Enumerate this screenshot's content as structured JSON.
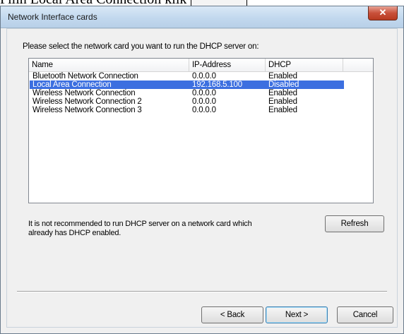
{
  "document": {
    "clipped_text": "Pilih Local Area Connection klik"
  },
  "window": {
    "title": "Network Interface cards",
    "close_symbol": "✕"
  },
  "instruction": "Please select the network card you want to run the DHCP server on:",
  "list": {
    "columns": [
      "Name",
      "IP-Address",
      "DHCP"
    ],
    "rows": [
      {
        "name": "Bluetooth Network Connection",
        "ip": "0.0.0.0",
        "dhcp": "Enabled",
        "selected": false
      },
      {
        "name": "Local Area Connection",
        "ip": "192.168.5.100",
        "dhcp": "Disabled",
        "selected": true
      },
      {
        "name": "Wireless Network Connection",
        "ip": "0.0.0.0",
        "dhcp": "Enabled",
        "selected": false
      },
      {
        "name": "Wireless Network Connection 2",
        "ip": "0.0.0.0",
        "dhcp": "Enabled",
        "selected": false
      },
      {
        "name": "Wireless Network Connection 3",
        "ip": "0.0.0.0",
        "dhcp": "Enabled",
        "selected": false
      }
    ]
  },
  "note": "It is not recommended to run DHCP server on a network card which already has DHCP enabled.",
  "buttons": {
    "refresh": "Refresh",
    "back": "< Back",
    "next": "Next >",
    "cancel": "Cancel"
  },
  "colors": {
    "selection": "#3c6fe0",
    "close_button": "#c8503a"
  }
}
